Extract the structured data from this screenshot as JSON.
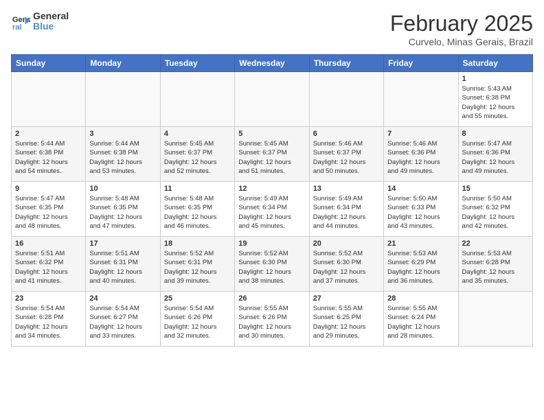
{
  "header": {
    "logo": {
      "line1": "General",
      "line2": "Blue"
    },
    "title": "February 2025",
    "subtitle": "Curvelo, Minas Gerais, Brazil"
  },
  "weekdays": [
    "Sunday",
    "Monday",
    "Tuesday",
    "Wednesday",
    "Thursday",
    "Friday",
    "Saturday"
  ],
  "weeks": [
    [
      {
        "day": "",
        "info": ""
      },
      {
        "day": "",
        "info": ""
      },
      {
        "day": "",
        "info": ""
      },
      {
        "day": "",
        "info": ""
      },
      {
        "day": "",
        "info": ""
      },
      {
        "day": "",
        "info": ""
      },
      {
        "day": "1",
        "info": "Sunrise: 5:43 AM\nSunset: 6:38 PM\nDaylight: 12 hours\nand 55 minutes."
      }
    ],
    [
      {
        "day": "2",
        "info": "Sunrise: 5:44 AM\nSunset: 6:38 PM\nDaylight: 12 hours\nand 54 minutes."
      },
      {
        "day": "3",
        "info": "Sunrise: 5:44 AM\nSunset: 6:38 PM\nDaylight: 12 hours\nand 53 minutes."
      },
      {
        "day": "4",
        "info": "Sunrise: 5:45 AM\nSunset: 6:37 PM\nDaylight: 12 hours\nand 52 minutes."
      },
      {
        "day": "5",
        "info": "Sunrise: 5:45 AM\nSunset: 6:37 PM\nDaylight: 12 hours\nand 51 minutes."
      },
      {
        "day": "6",
        "info": "Sunrise: 5:46 AM\nSunset: 6:37 PM\nDaylight: 12 hours\nand 50 minutes."
      },
      {
        "day": "7",
        "info": "Sunrise: 5:46 AM\nSunset: 6:36 PM\nDaylight: 12 hours\nand 49 minutes."
      },
      {
        "day": "8",
        "info": "Sunrise: 5:47 AM\nSunset: 6:36 PM\nDaylight: 12 hours\nand 49 minutes."
      }
    ],
    [
      {
        "day": "9",
        "info": "Sunrise: 5:47 AM\nSunset: 6:35 PM\nDaylight: 12 hours\nand 48 minutes."
      },
      {
        "day": "10",
        "info": "Sunrise: 5:48 AM\nSunset: 6:35 PM\nDaylight: 12 hours\nand 47 minutes."
      },
      {
        "day": "11",
        "info": "Sunrise: 5:48 AM\nSunset: 6:35 PM\nDaylight: 12 hours\nand 46 minutes."
      },
      {
        "day": "12",
        "info": "Sunrise: 5:49 AM\nSunset: 6:34 PM\nDaylight: 12 hours\nand 45 minutes."
      },
      {
        "day": "13",
        "info": "Sunrise: 5:49 AM\nSunset: 6:34 PM\nDaylight: 12 hours\nand 44 minutes."
      },
      {
        "day": "14",
        "info": "Sunrise: 5:50 AM\nSunset: 6:33 PM\nDaylight: 12 hours\nand 43 minutes."
      },
      {
        "day": "15",
        "info": "Sunrise: 5:50 AM\nSunset: 6:32 PM\nDaylight: 12 hours\nand 42 minutes."
      }
    ],
    [
      {
        "day": "16",
        "info": "Sunrise: 5:51 AM\nSunset: 6:32 PM\nDaylight: 12 hours\nand 41 minutes."
      },
      {
        "day": "17",
        "info": "Sunrise: 5:51 AM\nSunset: 6:31 PM\nDaylight: 12 hours\nand 40 minutes."
      },
      {
        "day": "18",
        "info": "Sunrise: 5:52 AM\nSunset: 6:31 PM\nDaylight: 12 hours\nand 39 minutes."
      },
      {
        "day": "19",
        "info": "Sunrise: 5:52 AM\nSunset: 6:30 PM\nDaylight: 12 hours\nand 38 minutes."
      },
      {
        "day": "20",
        "info": "Sunrise: 5:52 AM\nSunset: 6:30 PM\nDaylight: 12 hours\nand 37 minutes."
      },
      {
        "day": "21",
        "info": "Sunrise: 5:53 AM\nSunset: 6:29 PM\nDaylight: 12 hours\nand 36 minutes."
      },
      {
        "day": "22",
        "info": "Sunrise: 5:53 AM\nSunset: 6:28 PM\nDaylight: 12 hours\nand 35 minutes."
      }
    ],
    [
      {
        "day": "23",
        "info": "Sunrise: 5:54 AM\nSunset: 6:28 PM\nDaylight: 12 hours\nand 34 minutes."
      },
      {
        "day": "24",
        "info": "Sunrise: 5:54 AM\nSunset: 6:27 PM\nDaylight: 12 hours\nand 33 minutes."
      },
      {
        "day": "25",
        "info": "Sunrise: 5:54 AM\nSunset: 6:26 PM\nDaylight: 12 hours\nand 32 minutes."
      },
      {
        "day": "26",
        "info": "Sunrise: 5:55 AM\nSunset: 6:26 PM\nDaylight: 12 hours\nand 30 minutes."
      },
      {
        "day": "27",
        "info": "Sunrise: 5:55 AM\nSunset: 6:25 PM\nDaylight: 12 hours\nand 29 minutes."
      },
      {
        "day": "28",
        "info": "Sunrise: 5:55 AM\nSunset: 6:24 PM\nDaylight: 12 hours\nand 28 minutes."
      },
      {
        "day": "",
        "info": ""
      }
    ]
  ]
}
